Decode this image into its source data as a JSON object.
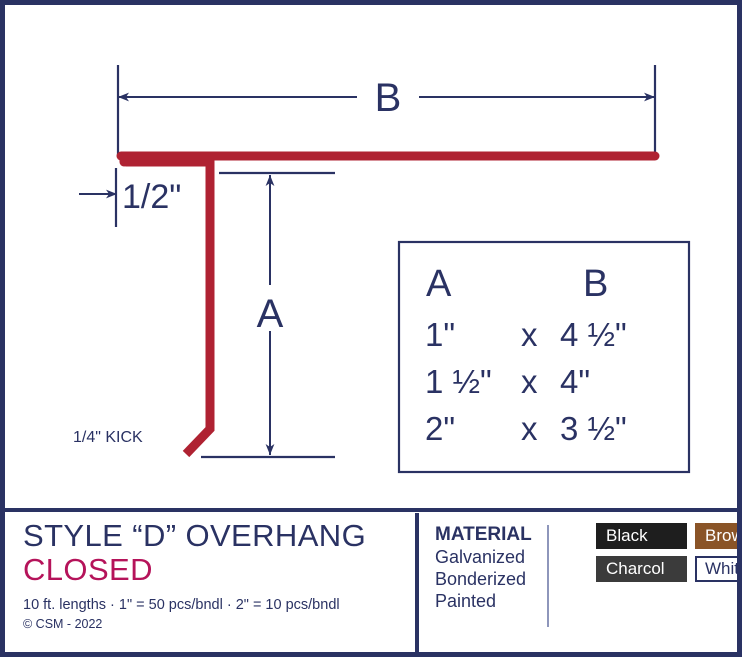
{
  "sheet": {
    "border_color": "#2a3263",
    "profile_color": "#af2232",
    "line_color": "#2a3263"
  },
  "diagram": {
    "dimension_b_label": "B",
    "dimension_a_label": "A",
    "flange_label": "1/2\"",
    "kick_label": "1/4\" KICK"
  },
  "size_table": {
    "headers": [
      "A",
      "B"
    ],
    "separator": "x",
    "rows": [
      {
        "a": "1\"",
        "x": "x",
        "b": "4 ½\""
      },
      {
        "a": "1 ½\"",
        "x": "x",
        "b": "4\""
      },
      {
        "a": "2\"",
        "x": "x",
        "b": "3 ½\""
      }
    ]
  },
  "title_block": {
    "title": "STYLE “D” OVERHANG",
    "subtitle": "CLOSED",
    "fineprint": "10 ft. lengths · 1\" = 50 pcs/bndl · 2\" = 10 pcs/bndl",
    "copyright": "© CSM - 2022"
  },
  "material": {
    "heading": "MATERIAL",
    "items": [
      "Galvanized",
      "Bonderized",
      "Painted"
    ],
    "swatches": [
      {
        "label": "Black",
        "bg": "#1e1e1e",
        "fg": "#ffffff",
        "border": "#1e1e1e"
      },
      {
        "label": "Brown",
        "bg": "#8a5427",
        "fg": "#ffffff",
        "border": "#8a5427"
      },
      {
        "label": "Charcol",
        "bg": "#3b3b3b",
        "fg": "#ffffff",
        "border": "#3b3b3b"
      },
      {
        "label": "White",
        "bg": "#ffffff",
        "fg": "#2a3263",
        "border": "#2a3263"
      }
    ]
  }
}
